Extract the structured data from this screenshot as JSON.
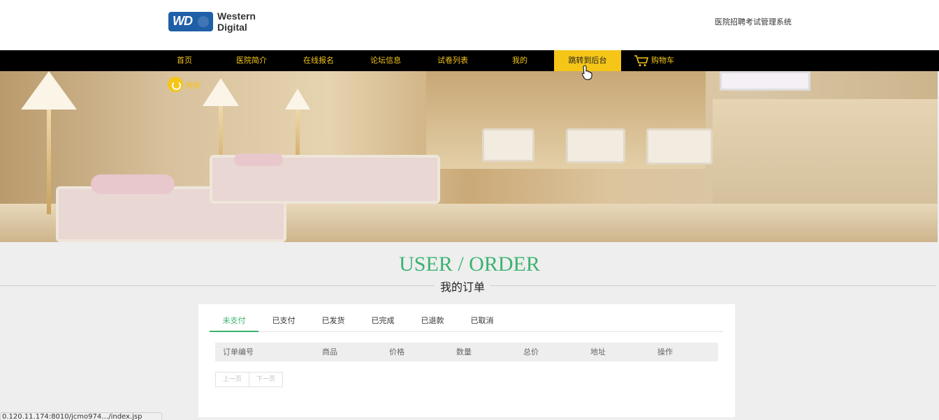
{
  "header": {
    "logo": {
      "line1": "Western",
      "line2": "Digital",
      "badge": "WD"
    },
    "site_title": "医院招聘考试管理系统"
  },
  "nav": {
    "items": [
      {
        "label": "首页"
      },
      {
        "label": "医院简介"
      },
      {
        "label": "在线报名"
      },
      {
        "label": "论坛信息"
      },
      {
        "label": "试卷列表"
      },
      {
        "label": "我的"
      },
      {
        "label": "跳转到后台"
      },
      {
        "label": "购物车"
      }
    ],
    "active_index": 6,
    "text_color": "#f5c518",
    "active_bg": "#f5c518"
  },
  "banner": {
    "service_label": "客服"
  },
  "page": {
    "title": "USER / ORDER",
    "subtitle": "我的订单",
    "title_color": "#3cb371"
  },
  "tabs": {
    "items": [
      "未支付",
      "已支付",
      "已发货",
      "已完成",
      "已退款",
      "已取消"
    ],
    "active_index": 0
  },
  "table": {
    "columns": [
      "订单编号",
      "商品",
      "价格",
      "数量",
      "总价",
      "地址",
      "操作"
    ],
    "rows": []
  },
  "pager": {
    "prev": "上一页",
    "next": "下一页"
  },
  "statusbar": {
    "url": "0.120.11.174:8010/jcmo974…/index.jsp"
  }
}
